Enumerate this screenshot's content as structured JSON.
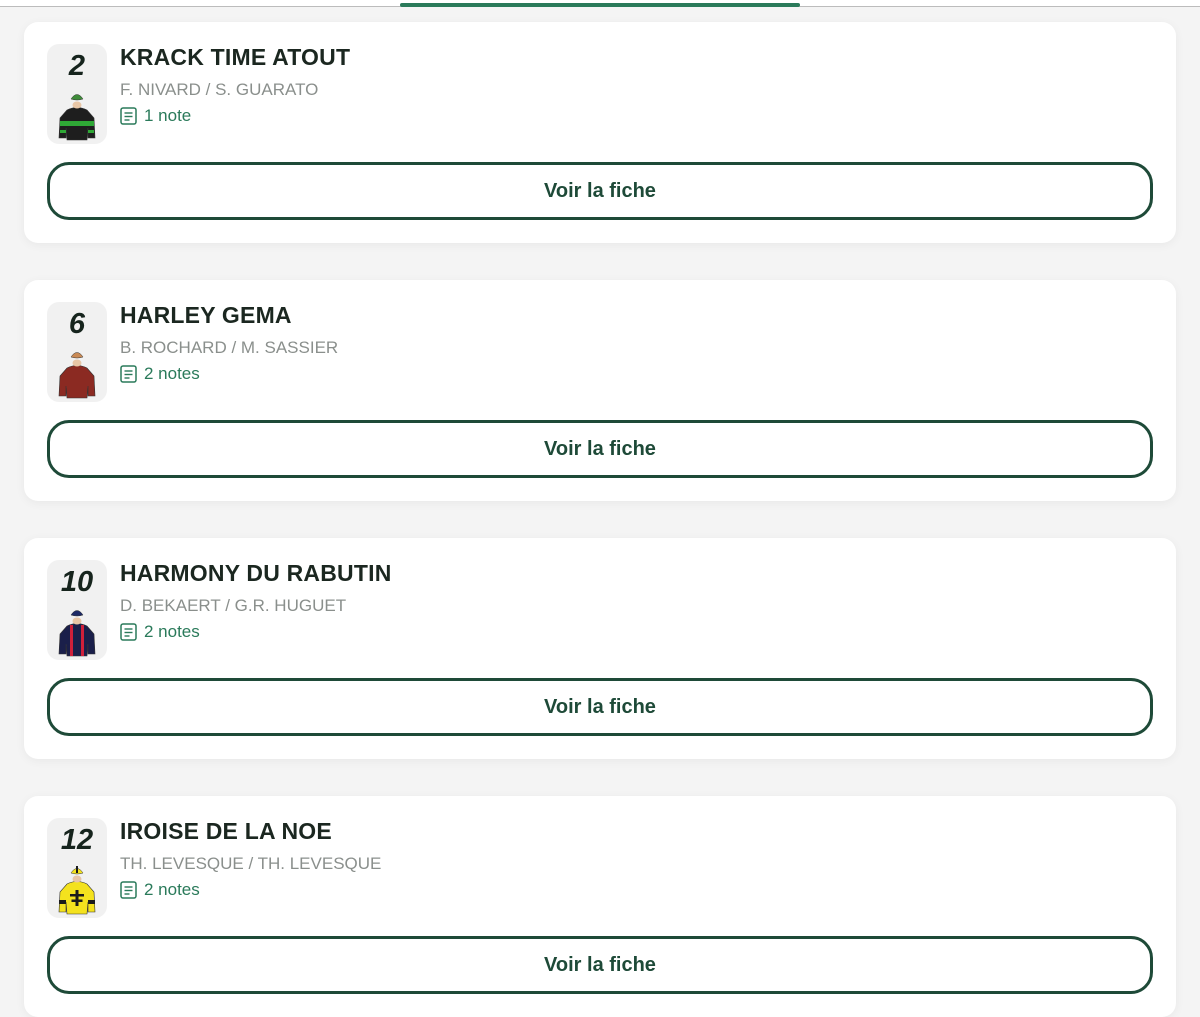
{
  "runners": [
    {
      "number": "2",
      "name": "KRACK TIME ATOUT",
      "people": "F. NIVARD / S. GUARATO",
      "notes": "1 note",
      "button": "Voir la fiche",
      "silk": {
        "cap": "#3f8c3a",
        "body": "#1e1e1e",
        "stripe": "#2fa836",
        "pattern": "hoop",
        "icon": "jockey-silk-black-green-hoop-icon"
      }
    },
    {
      "number": "6",
      "name": "HARLEY GEMA",
      "people": "B. ROCHARD / M. SASSIER",
      "notes": "2 notes",
      "button": "Voir la fiche",
      "silk": {
        "cap": "#c98a55",
        "body": "#8b2a22",
        "stripe": "#c98a55",
        "pattern": "plain",
        "icon": "jockey-silk-maroon-icon"
      }
    },
    {
      "number": "10",
      "name": "HARMONY DU RABUTIN",
      "people": "D. BEKAERT / G.R. HUGUET",
      "notes": "2 notes",
      "button": "Voir la fiche",
      "silk": {
        "cap": "#1e2a66",
        "body": "#1a1f4a",
        "stripe": "#d0203a",
        "pattern": "braces",
        "icon": "jockey-silk-navy-red-braces-icon"
      }
    },
    {
      "number": "12",
      "name": "IROISE DE LA NOE",
      "people": "TH. LEVESQUE / TH. LEVESQUE",
      "notes": "2 notes",
      "button": "Voir la fiche",
      "silk": {
        "cap": "#f4e21e",
        "body": "#f4e21e",
        "stripe": "#1b1b1b",
        "pattern": "cross",
        "icon": "jockey-silk-yellow-cross-icon"
      }
    }
  ],
  "colors": {
    "accent": "#2a7a5a",
    "button_border": "#1e4a38",
    "title": "#1b2720",
    "muted": "#8a8f8c"
  }
}
